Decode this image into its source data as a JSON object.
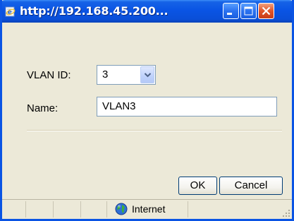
{
  "window": {
    "title": "http://192.168.45.200...",
    "icon": "ie-page-icon"
  },
  "form": {
    "vlan_id_label": "VLAN ID:",
    "vlan_id_value": "3",
    "name_label": "Name:",
    "name_value": "VLAN3"
  },
  "buttons": {
    "ok_label": "OK",
    "cancel_label": "Cancel"
  },
  "status": {
    "zone_label": "Internet",
    "zone_icon": "globe-icon"
  },
  "colors": {
    "titlebar": "#0a54e4",
    "close_button": "#e0542a",
    "window_bg": "#ece9d8"
  }
}
